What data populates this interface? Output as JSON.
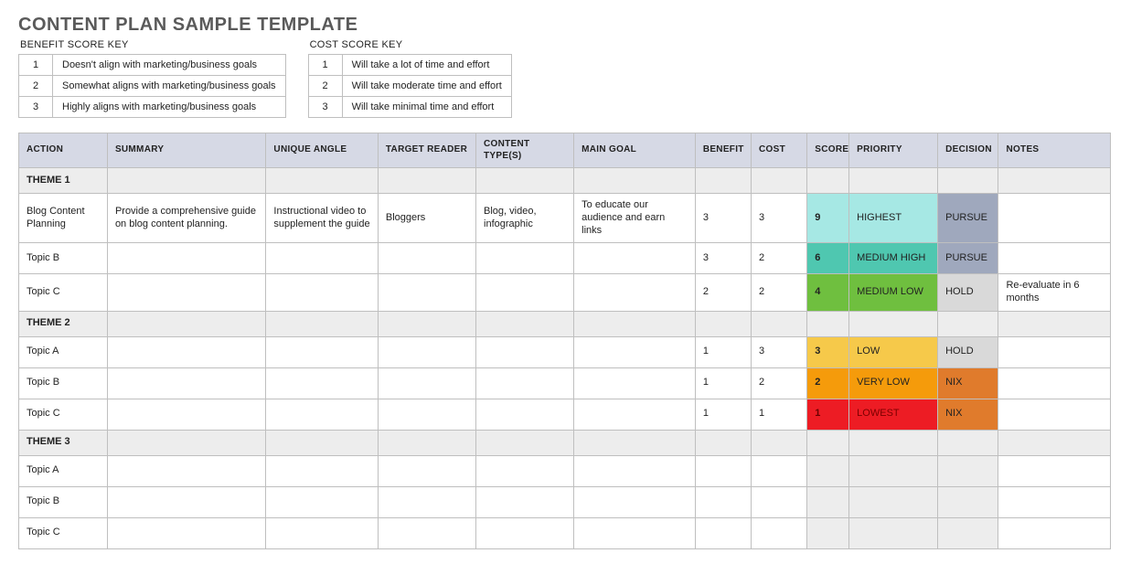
{
  "title": "CONTENT PLAN SAMPLE TEMPLATE",
  "benefit_key": {
    "title": "BENEFIT SCORE KEY",
    "rows": [
      {
        "n": "1",
        "txt": "Doesn't align with marketing/business goals"
      },
      {
        "n": "2",
        "txt": "Somewhat aligns with marketing/business goals"
      },
      {
        "n": "3",
        "txt": "Highly aligns with marketing/business goals"
      }
    ]
  },
  "cost_key": {
    "title": "COST SCORE KEY",
    "rows": [
      {
        "n": "1",
        "txt": "Will take a lot of time and effort"
      },
      {
        "n": "2",
        "txt": "Will take moderate time and effort"
      },
      {
        "n": "3",
        "txt": "Will take minimal time and effort"
      }
    ]
  },
  "headers": {
    "action": "ACTION",
    "summary": "SUMMARY",
    "angle": "UNIQUE ANGLE",
    "reader": "TARGET READER",
    "types": "CONTENT TYPE(S)",
    "goal": "MAIN GOAL",
    "benefit": "BENEFIT",
    "cost": "COST",
    "score": "SCORE",
    "priority": "PRIORITY",
    "decision": "DECISION",
    "notes": "NOTES"
  },
  "themes": [
    {
      "name": "THEME 1",
      "rows": [
        {
          "action": "Blog Content Planning",
          "summary": "Provide a comprehensive guide on blog content planning.",
          "angle": "Instructional video to supplement the guide",
          "reader": "Bloggers",
          "types": "Blog, video, infographic",
          "goal": "To educate our audience and earn links",
          "benefit": "3",
          "cost": "3",
          "score": "9",
          "score_cls": "bg-highest",
          "priority": "HIGHEST",
          "priority_cls": "bg-highest",
          "decision": "PURSUE",
          "decision_cls": "bg-pursue",
          "notes": ""
        },
        {
          "action": "Topic B",
          "summary": "",
          "angle": "",
          "reader": "",
          "types": "",
          "goal": "",
          "benefit": "3",
          "cost": "2",
          "score": "6",
          "score_cls": "bg-medhigh",
          "priority": "MEDIUM HIGH",
          "priority_cls": "bg-medhigh",
          "decision": "PURSUE",
          "decision_cls": "bg-pursue",
          "notes": ""
        },
        {
          "action": "Topic C",
          "summary": "",
          "angle": "",
          "reader": "",
          "types": "",
          "goal": "",
          "benefit": "2",
          "cost": "2",
          "score": "4",
          "score_cls": "bg-medlow",
          "priority": "MEDIUM LOW",
          "priority_cls": "bg-medlow",
          "decision": "HOLD",
          "decision_cls": "bg-hold",
          "notes": "Re-evaluate in 6 months"
        }
      ]
    },
    {
      "name": "THEME 2",
      "rows": [
        {
          "action": "Topic A",
          "summary": "",
          "angle": "",
          "reader": "",
          "types": "",
          "goal": "",
          "benefit": "1",
          "cost": "3",
          "score": "3",
          "score_cls": "bg-low",
          "priority": "LOW",
          "priority_cls": "bg-low",
          "decision": "HOLD",
          "decision_cls": "bg-hold",
          "notes": ""
        },
        {
          "action": "Topic B",
          "summary": "",
          "angle": "",
          "reader": "",
          "types": "",
          "goal": "",
          "benefit": "1",
          "cost": "2",
          "score": "2",
          "score_cls": "bg-verylow",
          "priority": "VERY LOW",
          "priority_cls": "bg-verylow",
          "decision": "NIX",
          "decision_cls": "bg-nix",
          "notes": ""
        },
        {
          "action": "Topic C",
          "summary": "",
          "angle": "",
          "reader": "",
          "types": "",
          "goal": "",
          "benefit": "1",
          "cost": "1",
          "score": "1",
          "score_cls": "bg-lowest",
          "priority": "LOWEST",
          "priority_cls": "bg-lowest bg-lowest-txt",
          "decision": "NIX",
          "decision_cls": "bg-nix",
          "notes": ""
        }
      ]
    },
    {
      "name": "THEME 3",
      "rows": [
        {
          "action": "Topic A",
          "summary": "",
          "angle": "",
          "reader": "",
          "types": "",
          "goal": "",
          "benefit": "",
          "cost": "",
          "score": "",
          "score_cls": "blank-grey",
          "priority": "",
          "priority_cls": "blank-grey",
          "decision": "",
          "decision_cls": "blank-grey",
          "notes": ""
        },
        {
          "action": "Topic B",
          "summary": "",
          "angle": "",
          "reader": "",
          "types": "",
          "goal": "",
          "benefit": "",
          "cost": "",
          "score": "",
          "score_cls": "blank-grey",
          "priority": "",
          "priority_cls": "blank-grey",
          "decision": "",
          "decision_cls": "blank-grey",
          "notes": ""
        },
        {
          "action": "Topic C",
          "summary": "",
          "angle": "",
          "reader": "",
          "types": "",
          "goal": "",
          "benefit": "",
          "cost": "",
          "score": "",
          "score_cls": "blank-grey",
          "priority": "",
          "priority_cls": "blank-grey",
          "decision": "",
          "decision_cls": "blank-grey",
          "notes": ""
        }
      ]
    }
  ]
}
